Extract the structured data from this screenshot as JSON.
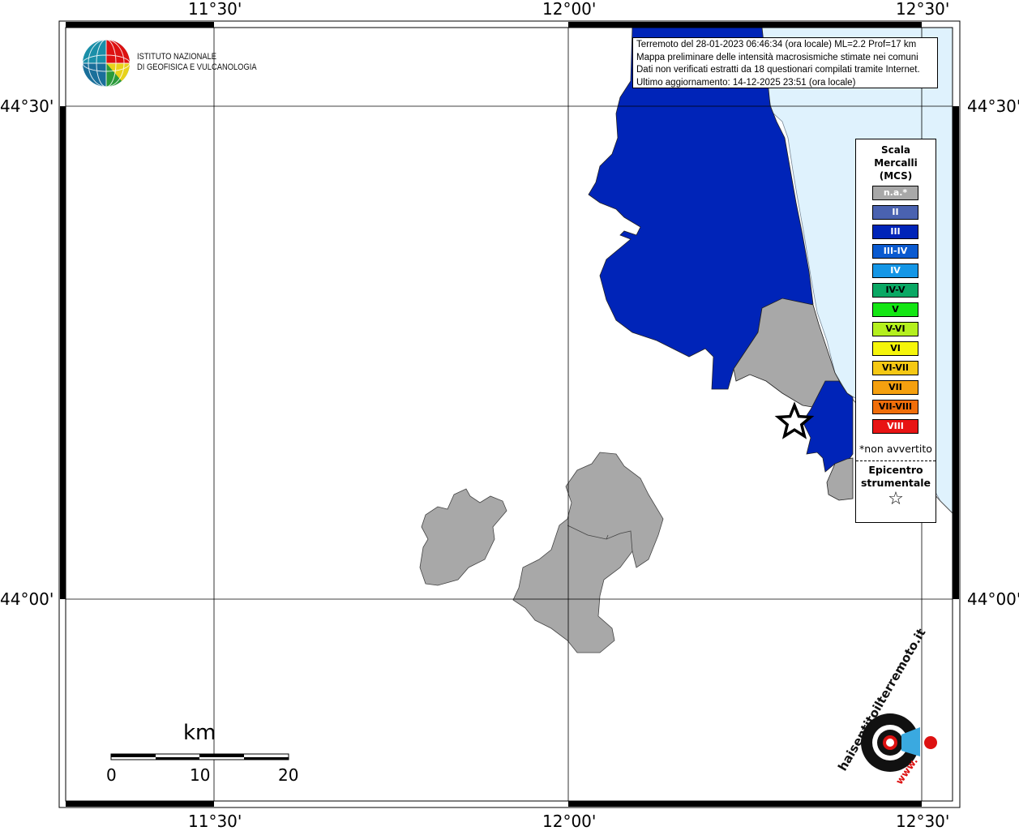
{
  "map": {
    "lon_labels": [
      "11°30'",
      "12°00'",
      "12°30'"
    ],
    "lat_labels": [
      "44°30'",
      "44°00'"
    ],
    "colors": {
      "sea": "#dff2fd",
      "intensity_III": "#0024b8",
      "not_available": "#a8a8a8",
      "land": "#ffffff"
    }
  },
  "logo": {
    "line1": "ISTITUTO NAZIONALE",
    "line2": "DI GEOFISICA E VULCANOLOGIA"
  },
  "info": {
    "line1": "Terremoto del 28-01-2023 06:46:34 (ora locale) ML=2.2 Prof=17 km",
    "line2": "Mappa preliminare delle intensità macrosismiche stimate nei comuni",
    "line3": "Dati non verificati estratti da 18 questionari compilati tramite Internet.",
    "line4": "Ultimo aggiornamento: 14-12-2025 23:51 (ora locale)"
  },
  "legend": {
    "title1": "Scala",
    "title2": "Mercalli",
    "title3": "(MCS)",
    "items": [
      {
        "label": "n.a.*",
        "color": "#a8a8a8",
        "text_color": "#ffffff"
      },
      {
        "label": "II",
        "color": "#4a62b0",
        "text_color": "#ffffff"
      },
      {
        "label": "III",
        "color": "#0024b8",
        "text_color": "#ffffff"
      },
      {
        "label": "III-IV",
        "color": "#0a5ad0",
        "text_color": "#ffffff"
      },
      {
        "label": "IV",
        "color": "#1496e6",
        "text_color": "#ffffff"
      },
      {
        "label": "IV-V",
        "color": "#0aa864",
        "text_color": "#000000"
      },
      {
        "label": "V",
        "color": "#14e614",
        "text_color": "#000000"
      },
      {
        "label": "V-VI",
        "color": "#b4f01e",
        "text_color": "#000000"
      },
      {
        "label": "VI",
        "color": "#f5f50a",
        "text_color": "#000000"
      },
      {
        "label": "VI-VII",
        "color": "#f5c814",
        "text_color": "#000000"
      },
      {
        "label": "VII",
        "color": "#f5a00f",
        "text_color": "#000000"
      },
      {
        "label": "VII-VIII",
        "color": "#f06e0a",
        "text_color": "#000000"
      },
      {
        "label": "VIII",
        "color": "#e81414",
        "text_color": "#ffffff"
      }
    ],
    "note": "*non avvertito",
    "epicenter1": "Epicentro",
    "epicenter2": "strumentale",
    "star": "☆"
  },
  "scale_bar": {
    "unit": "km",
    "ticks": [
      "0",
      "10",
      "20"
    ]
  },
  "watermark": {
    "text": "haisentitoilterremoto.it",
    "www": "www."
  }
}
